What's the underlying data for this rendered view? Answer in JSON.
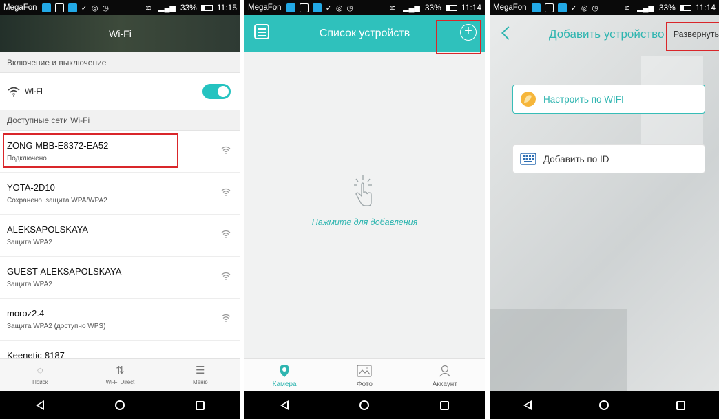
{
  "status": {
    "carrier": "MegaFon",
    "signal": "ᴴıl",
    "battery": "33%",
    "time_p1": "11:15",
    "time_p2": "11:14",
    "time_p3": "11:14"
  },
  "panel1": {
    "title": "Wi-Fi",
    "section_toggle": "Включение и выключение",
    "wifi_label": "Wi-Fi",
    "wifi_enabled": true,
    "section_available": "Доступные сети Wi-Fi",
    "networks": [
      {
        "name": "ZONG MBB-E8372-EA52",
        "status": "Подключено"
      },
      {
        "name": "YOTA-2D10",
        "status": "Сохранено, защита WPA/WPA2"
      },
      {
        "name": "ALEKSAPOLSKAYA",
        "status": "Защита WPA2"
      },
      {
        "name": "GUEST-ALEKSAPOLSKAYA",
        "status": "Защита WPA2"
      },
      {
        "name": "moroz2.4",
        "status": "Защита WPA2 (доступно WPS)"
      },
      {
        "name": "Keenetic-8187",
        "status": ""
      }
    ],
    "tabs": [
      {
        "label": "Поиск",
        "icon": "refresh-icon"
      },
      {
        "label": "Wi-Fi Direct",
        "icon": "wifi-direct-icon"
      },
      {
        "label": "Меню",
        "icon": "menu-icon"
      }
    ]
  },
  "panel2": {
    "title": "Список устройств",
    "plus": "+",
    "empty_text": "Нажмите для добавления",
    "accent": "#2fc1bc",
    "tabs": [
      {
        "label": "Камера",
        "icon": "camera-pin-icon"
      },
      {
        "label": "Фото",
        "icon": "photo-icon"
      },
      {
        "label": "Аккаунт",
        "icon": "account-icon"
      }
    ]
  },
  "panel3": {
    "title": "Добавить устройство",
    "expand": "Развернуть",
    "options": [
      {
        "label": "Настроить по WIFI",
        "icon": "wifi-setup-icon"
      },
      {
        "label": "Добавить по ID",
        "icon": "keyboard-icon"
      }
    ]
  },
  "colors": {
    "highlight": "#d9262a",
    "teal": "#2fb5b0"
  }
}
